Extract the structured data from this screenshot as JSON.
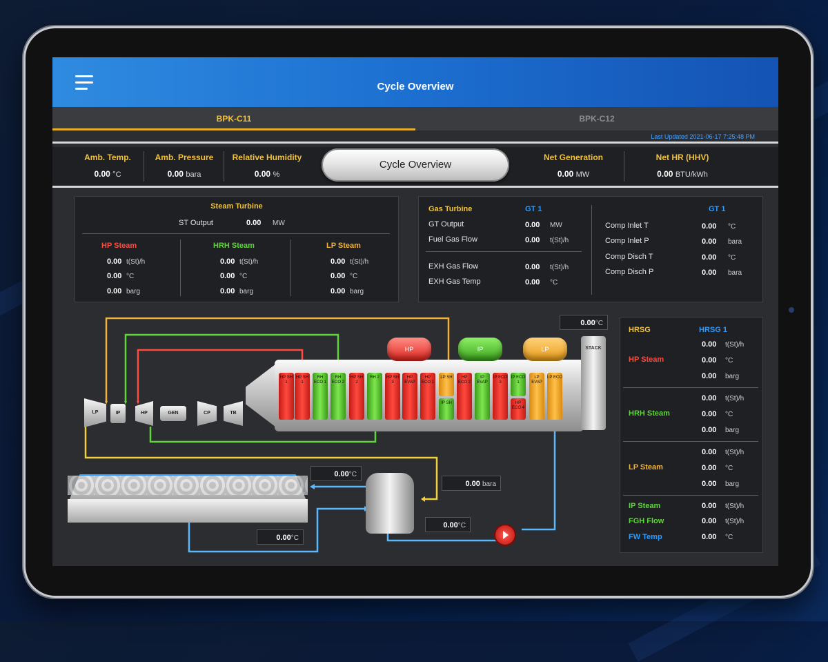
{
  "app": {
    "title": "Cycle Overview"
  },
  "tabs": [
    {
      "label": "BPK-C11"
    },
    {
      "label": "BPK-C12"
    }
  ],
  "last_updated": "Last Updated 2021-06-17  7:25:48 PM",
  "metrics": {
    "amb_temp": {
      "label": "Amb. Temp.",
      "value": "0.00",
      "unit": "°C"
    },
    "amb_pressure": {
      "label": "Amb. Pressure",
      "value": "0.00",
      "unit": "bara"
    },
    "humidity": {
      "label": "Relative Humidity",
      "value": "0.00",
      "unit": "%"
    },
    "center_button": "Cycle Overview",
    "net_gen": {
      "label": "Net Generation",
      "value": "0.00",
      "unit": "MW"
    },
    "net_hr": {
      "label": "Net HR (HHV)",
      "value": "0.00",
      "unit": "BTU/kWh"
    }
  },
  "steam_turbine": {
    "title": "Steam Turbine",
    "st_output_label": "ST Output",
    "st_output_value": "0.00",
    "st_output_unit": "MW",
    "hp": {
      "title": "HP Steam",
      "rows": [
        {
          "v": "0.00",
          "u": "t(St)/h"
        },
        {
          "v": "0.00",
          "u": "°C"
        },
        {
          "v": "0.00",
          "u": "barg"
        }
      ]
    },
    "hrh": {
      "title": "HRH Steam",
      "rows": [
        {
          "v": "0.00",
          "u": "t(St)/h"
        },
        {
          "v": "0.00",
          "u": "°C"
        },
        {
          "v": "0.00",
          "u": "barg"
        }
      ]
    },
    "lp": {
      "title": "LP Steam",
      "rows": [
        {
          "v": "0.00",
          "u": "t(St)/h"
        },
        {
          "v": "0.00",
          "u": "°C"
        },
        {
          "v": "0.00",
          "u": "barg"
        }
      ]
    }
  },
  "gas_turbine": {
    "title": "Gas Turbine",
    "unit_name": "GT 1",
    "unit_name2": "GT 1",
    "left": [
      {
        "label": "GT Output",
        "v": "0.00",
        "u": "MW"
      },
      {
        "label": "Fuel Gas Flow",
        "v": "0.00",
        "u": "t(St)/h"
      },
      {
        "label": "EXH Gas Flow",
        "v": "0.00",
        "u": "t(St)/h"
      },
      {
        "label": "EXH Gas Temp",
        "v": "0.00",
        "u": "°C"
      }
    ],
    "right": [
      {
        "label": "Comp Inlet T",
        "v": "0.00",
        "u": "°C"
      },
      {
        "label": "Comp Inlet P",
        "v": "0.00",
        "u": "bara"
      },
      {
        "label": "Comp Disch T",
        "v": "0.00",
        "u": "°C"
      },
      {
        "label": "Comp Disch P",
        "v": "0.00",
        "u": "bara"
      }
    ]
  },
  "hrsg": {
    "title": "HRSG",
    "unit_name": "HRSG 1",
    "hp": {
      "label": "HP Steam",
      "rows": [
        {
          "v": "0.00",
          "u": "t(St)/h"
        },
        {
          "v": "0.00",
          "u": "°C"
        },
        {
          "v": "0.00",
          "u": "barg"
        }
      ]
    },
    "hrh": {
      "label": "HRH Steam",
      "rows": [
        {
          "v": "0.00",
          "u": "t(St)/h"
        },
        {
          "v": "0.00",
          "u": "°C"
        },
        {
          "v": "0.00",
          "u": "barg"
        }
      ]
    },
    "lp": {
      "label": "LP Steam",
      "rows": [
        {
          "v": "0.00",
          "u": "t(St)/h"
        },
        {
          "v": "0.00",
          "u": "°C"
        },
        {
          "v": "0.00",
          "u": "barg"
        }
      ]
    },
    "misc": [
      {
        "label": "IP Steam",
        "v": "0.00",
        "u": "t(St)/h"
      },
      {
        "label": "FGH Flow",
        "v": "0.00",
        "u": "t(St)/h"
      },
      {
        "label": "FW Temp",
        "v": "0.00",
        "u": "°C"
      }
    ]
  },
  "diagram": {
    "stack_temp": {
      "v": "0.00",
      "u": "°C"
    },
    "stack_label": "STACK",
    "drums": {
      "hp": "HP",
      "ip": "IP",
      "lp": "LP"
    },
    "machines": {
      "lp": "LP",
      "ip": "IP",
      "hp": "HP",
      "gen": "GEN",
      "cp": "CP",
      "tb": "TB"
    },
    "tubes": [
      "HP SH 1",
      "HP SH 1",
      "RH ECO 1",
      "RH ECO 2",
      "HP SH 2",
      "RH 2",
      "HP SH 3",
      "HP EVAP",
      "HP ECO 1",
      "LP SH",
      "HP ECO 2",
      "IP EVAP",
      "IP ECO 3",
      "IP ECO 1",
      "IP SH",
      "LP EVAP",
      "LP ECO",
      "HP ECO 4",
      "IP SH"
    ],
    "cond_temp": {
      "v": "0.00",
      "u": "°C"
    },
    "cond_pressure": {
      "v": "0.00",
      "u": "bara"
    },
    "cw_temp": {
      "v": "0.00",
      "u": "°C"
    },
    "pump_temp": {
      "v": "0.00",
      "u": "°C"
    }
  },
  "colors": {
    "accent": "#f2c23a",
    "hp": "#ff4b3e",
    "hrh": "#5fd63b",
    "lp": "#f2b13a",
    "water": "#2f9cff"
  }
}
